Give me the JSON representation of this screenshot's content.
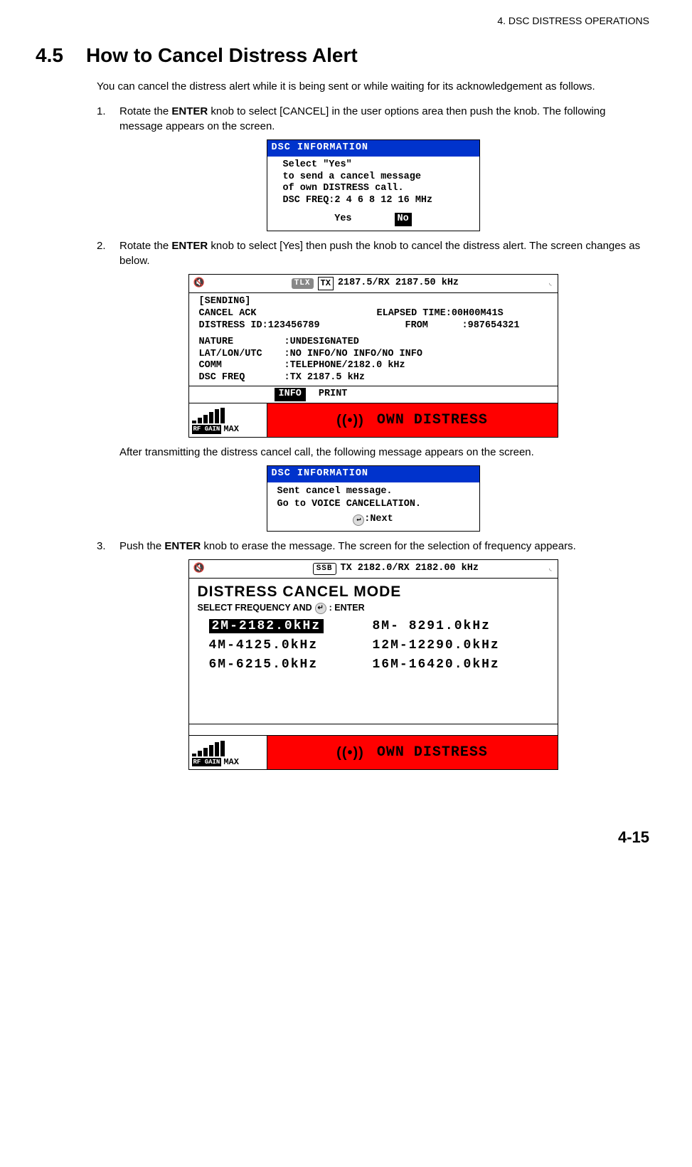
{
  "chapter_header": "4.  DSC DISTRESS OPERATIONS",
  "section_number": "4.5",
  "section_title": "How to Cancel Distress Alert",
  "intro": "You can cancel the distress alert while it is being sent or while waiting for its acknowledgement as follows.",
  "step1": {
    "num": "1.",
    "pre": "Rotate the ",
    "bold": "ENTER",
    "post": " knob to select [CANCEL] in the user options area then push the knob. The following message appears on the screen."
  },
  "dlg1": {
    "title": "DSC INFORMATION",
    "l1": "Select \"Yes\"",
    "l2": "to send a cancel message",
    "l3": "of own DISTRESS call.",
    "l4": "DSC FREQ:2 4 6 8 12 16 MHz",
    "yes": "Yes",
    "no": "No"
  },
  "step2": {
    "num": "2.",
    "pre": "Rotate the ",
    "bold": "ENTER",
    "post": " knob to select [Yes] then push the knob to cancel the distress alert. The screen changes as below."
  },
  "scr2": {
    "tlx": "TLX",
    "tx": "TX",
    "freq": "2187.5/RX 2187.50 kHz",
    "sending": "[SENDING]",
    "cancel_ack": "CANCEL ACK",
    "elapsed_lbl": "ELAPSED TIME:",
    "elapsed_val": "00H00M41S",
    "distress_id_lbl": "DISTRESS ID:",
    "distress_id_val": "123456789",
    "from_lbl": "FROM",
    "from_val": ":987654321",
    "nature_lbl": "NATURE",
    "nature_val": ":UNDESIGNATED",
    "latlon_lbl": "LAT/LON/UTC",
    "latlon_val": ":NO INFO/NO INFO/NO INFO",
    "comm_lbl": "COMM",
    "comm_val": ":TELEPHONE/2182.0 kHz",
    "dscfreq_lbl": "DSC FREQ",
    "dscfreq_val": ":TX 2187.5 kHz",
    "info": "INFO",
    "print": "PRINT",
    "rfgain": "RF GAIN",
    "max": "MAX",
    "own": "OWN DISTRESS"
  },
  "after2": "After transmitting the distress cancel call, the following message appears on the screen.",
  "dlg3": {
    "title": "DSC INFORMATION",
    "l1": "Sent cancel message.",
    "l2": "Go to VOICE CANCELLATION.",
    "next": ":Next"
  },
  "step3": {
    "num": "3.",
    "pre": "Push the ",
    "bold": "ENTER",
    "post": " knob to erase the message. The screen for the selection of frequency appears."
  },
  "scr4": {
    "ssb": "SSB",
    "freq": "TX 2182.0/RX 2182.00 kHz",
    "title": "DISTRESS CANCEL MODE",
    "sub_pre": "SELECT FREQUENCY AND ",
    "sub_post": " : ENTER",
    "f1": "2M-2182.0kHz",
    "f2": "8M- 8291.0kHz",
    "f3": "4M-4125.0kHz",
    "f4": "12M-12290.0kHz",
    "f5": "6M-6215.0kHz",
    "f6": "16M-16420.0kHz",
    "rfgain": "RF GAIN",
    "max": "MAX",
    "own": "OWN DISTRESS"
  },
  "page_num": "4-15"
}
